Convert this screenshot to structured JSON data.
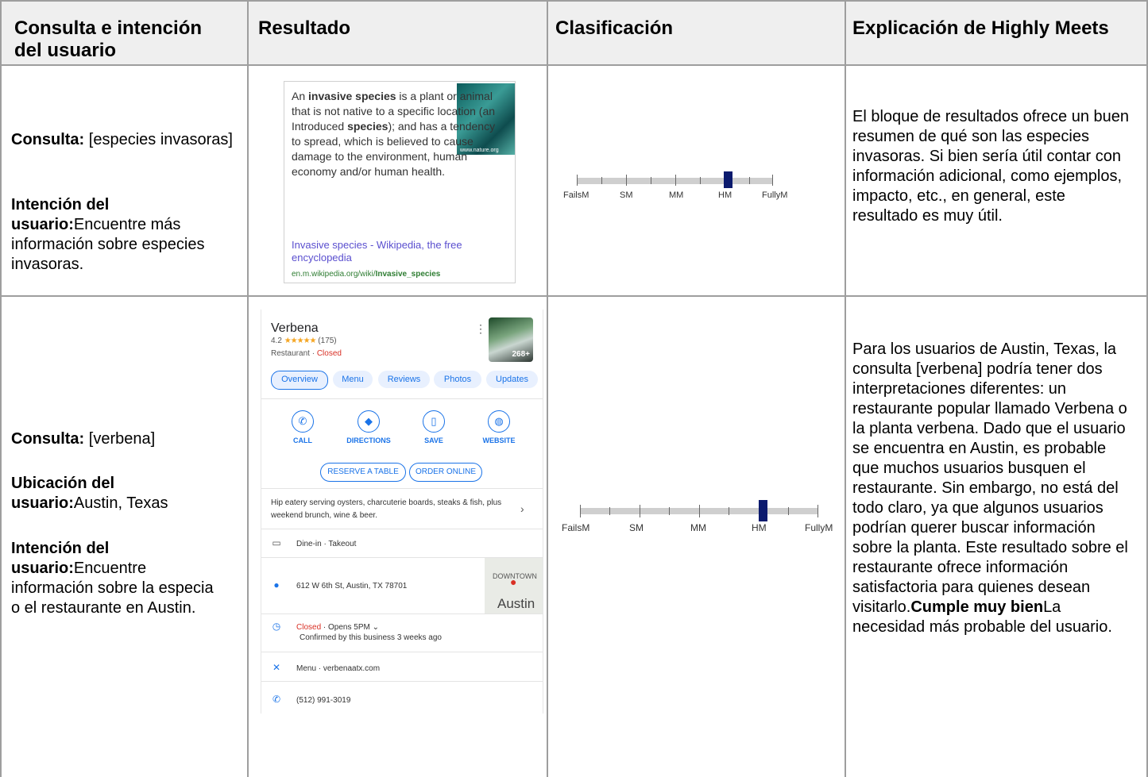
{
  "headers": [
    "Consulta e intención\ndel usuario",
    "Resultado",
    "Clasificación",
    "Explicación de Highly Meets"
  ],
  "row1": {
    "query_label": "Consulta:",
    "query_value": " [especies invasoras]",
    "intent_label": "Intención del usuario:",
    "intent_value": "Encuentre más información sobre especies invasoras.",
    "snippet": {
      "text_html_parts": [
        "An ",
        "invasive species",
        " is a plant or animal that is not native to a specific location (an Introduced ",
        "species",
        "); and has a tendency to spread, which is believed to cause damage to the environment, human economy and/or human health."
      ],
      "image_credit": "www.nature.org",
      "link": "Invasive species - Wikipedia, the free encyclopedia",
      "url_prefix": "en.m.wikipedia.org/wiki/",
      "url_bold": "Invasive_species"
    },
    "scale_labels": [
      "FailsM",
      "SM",
      "MM",
      "HM",
      "FullyM"
    ],
    "rating_position": 0.75,
    "explanation": "El bloque de resultados ofrece un buen resumen de qué son las especies invasoras. Si bien sería útil contar con información adicional, como ejemplos, impacto, etc., en general, este resultado es muy útil."
  },
  "row2": {
    "query_label": "Consulta:",
    "query_value": " [verbena]",
    "location_label": "Ubicación del usuario:",
    "location_value": "Austin, Texas",
    "intent_label": "Intención del usuario:",
    "intent_value": "Encuentre información sobre la especia o el restaurante en Austin.",
    "card": {
      "name": "Verbena",
      "rating": "4.2",
      "stars": "★★★★★",
      "reviews": "(175)",
      "type": "Restaurant · ",
      "status": "Closed",
      "photo_count": "268+",
      "tabs": [
        "Overview",
        "Menu",
        "Reviews",
        "Photos",
        "Updates"
      ],
      "actions": [
        {
          "label": "CALL",
          "icon": "phone-icon",
          "glyph": "✆"
        },
        {
          "label": "DIRECTIONS",
          "icon": "directions-icon",
          "glyph": "◆"
        },
        {
          "label": "SAVE",
          "icon": "bookmark-icon",
          "glyph": "▯"
        },
        {
          "label": "WEBSITE",
          "icon": "globe-icon",
          "glyph": "◍"
        }
      ],
      "reserve": "RESERVE A TABLE",
      "order": "ORDER ONLINE",
      "description": "Hip eatery serving oysters, charcuterie boards, steaks & fish, plus weekend brunch, wine & beer.",
      "service": "Dine-in · Takeout",
      "address": "612 W 6th St, Austin, TX 78701",
      "map_text_1": "DOWNTOWN",
      "map_text_2": "Austin",
      "hours_status": "Closed",
      "hours_rest": " · Opens 5PM  ⌄",
      "hours_confirmed": "Confirmed by this business 3 weeks ago",
      "menu": "Menu · verbenaatx.com",
      "phone": "(512) 991-3019"
    },
    "scale_labels": [
      "FailsM",
      "SM",
      "MM",
      "HM",
      "FullyM"
    ],
    "rating_position": 0.75,
    "explanation_main": "Para los usuarios de Austin, Texas, la consulta [verbena] podría tener dos interpretaciones diferentes: un restaurante popular llamado Verbena o la planta verbena. Dado que el usuario se encuentra en Austin, es probable que muchos usuarios busquen el restaurante. Sin embargo, no está del todo claro, ya que algunos usuarios podrían querer buscar información sobre la planta. Este resultado sobre el restaurante ofrece información satisfactoria para quienes desean visitarlo.",
    "explanation_bold": "Cumple muy bien",
    "explanation_tail": "La necesidad más probable del usuario."
  }
}
